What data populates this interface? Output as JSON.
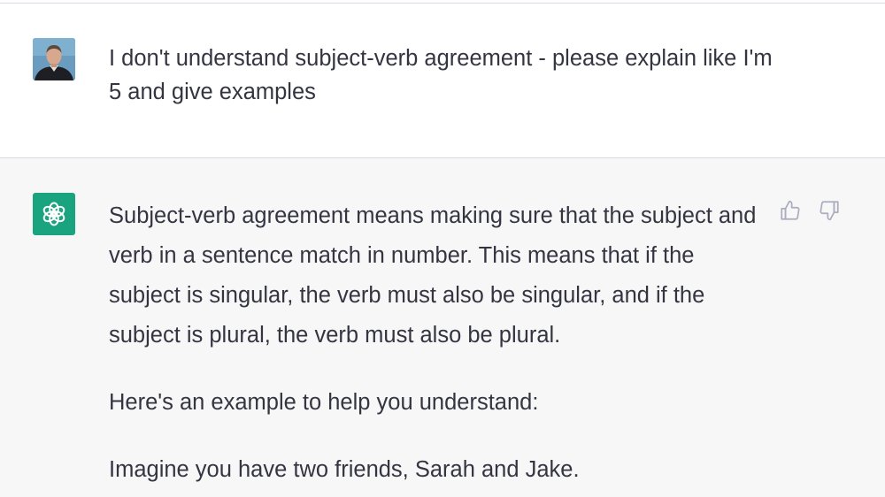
{
  "conversation": {
    "user_message": {
      "avatar_icon": "user-avatar-photo",
      "text": "I don't understand subject-verb agreement - please explain like I'm 5 and give examples"
    },
    "assistant_message": {
      "logo_icon": "openai-logo-icon",
      "logo_color": "#19a37f",
      "paragraphs": [
        "Subject-verb agreement means making sure that the subject and verb in a sentence match in number. This means that if the subject is singular, the verb must also be singular, and if the subject is plural, the verb must also be plural.",
        "Here's an example to help you understand:",
        "Imagine you have two friends, Sarah and Jake."
      ],
      "feedback": {
        "thumbs_up_icon": "thumbs-up-icon",
        "thumbs_down_icon": "thumbs-down-icon"
      }
    },
    "colors": {
      "text": "#343541",
      "assistant_bg": "#f7f7f8",
      "divider": "#d9d9e3",
      "icon_gray": "#acacbe"
    }
  }
}
